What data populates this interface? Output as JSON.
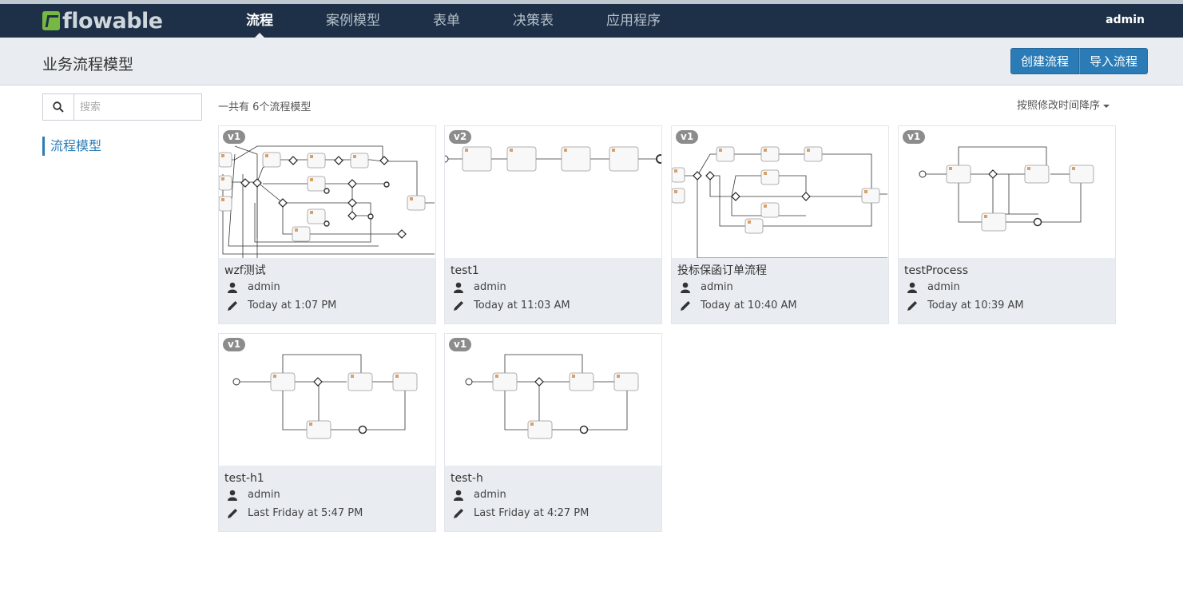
{
  "app": {
    "logo_prefix": "f",
    "logo_text": "flowable",
    "user": "admin"
  },
  "nav": [
    {
      "label": "流程",
      "active": true
    },
    {
      "label": "案例模型",
      "active": false
    },
    {
      "label": "表单",
      "active": false
    },
    {
      "label": "决策表",
      "active": false
    },
    {
      "label": "应用程序",
      "active": false
    }
  ],
  "header": {
    "title": "业务流程模型",
    "create_label": "创建流程",
    "import_label": "导入流程"
  },
  "sidebar": {
    "search_placeholder": "搜索",
    "link_label": "流程模型"
  },
  "list": {
    "count_text": "一共有 6个流程模型",
    "sort_label": "按照修改时间降序"
  },
  "models": [
    {
      "name": "wzf测试",
      "version": "v1",
      "user": "admin",
      "modified": "Today at 1:07 PM"
    },
    {
      "name": "test1",
      "version": "v2",
      "user": "admin",
      "modified": "Today at 11:03 AM"
    },
    {
      "name": "投标保函订单流程",
      "version": "v1",
      "user": "admin",
      "modified": "Today at 10:40 AM"
    },
    {
      "name": "testProcess",
      "version": "v1",
      "user": "admin",
      "modified": "Today at 10:39 AM"
    },
    {
      "name": "test-h1",
      "version": "v1",
      "user": "admin",
      "modified": "Last Friday at 5:47 PM"
    },
    {
      "name": "test-h",
      "version": "v1",
      "user": "admin",
      "modified": "Last Friday at 4:27 PM"
    }
  ],
  "colors": {
    "topbar": "#1d3047",
    "accent": "#2b7cb6",
    "logo_green": "#77b843",
    "subheader": "#e9edf1"
  }
}
